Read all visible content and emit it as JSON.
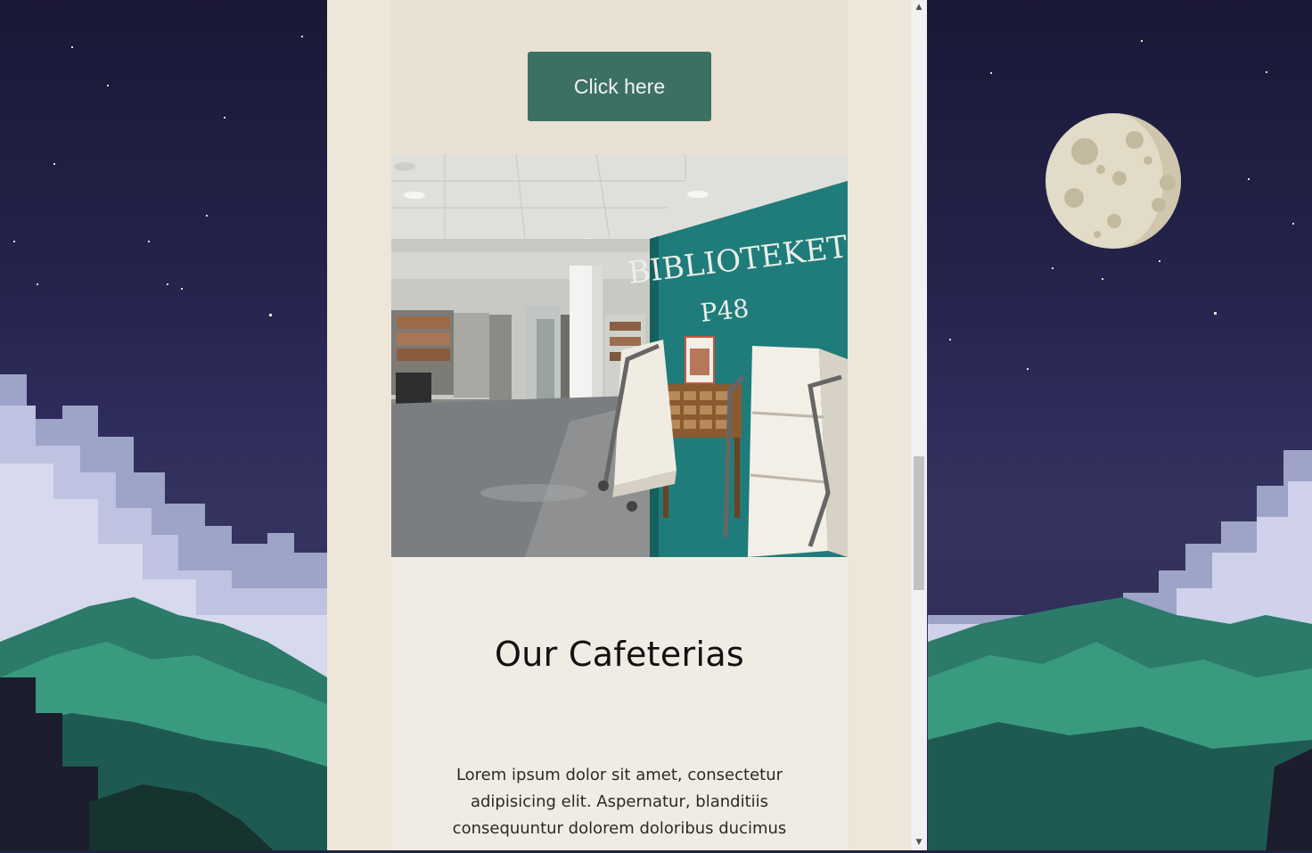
{
  "page": {
    "cta_label": "Click here",
    "section_title": "Our Cafeterias",
    "section_body": "Lorem ipsum dolor sit amet, consectetur adipisicing elit. Aspernatur, blanditiis consequuntur dolorem doloribus ducimus",
    "photo": {
      "sign_line1": "BIBLIOTEKET",
      "sign_line2": "P48"
    }
  },
  "icons": {
    "scroll_up": "triangle-up-icon",
    "scroll_down": "triangle-down-icon"
  },
  "colors": {
    "button_bg": "#3c7064",
    "button_text": "#f2f2f2",
    "panel_bg": "#ece5d8",
    "sky_dark": "#1a1836",
    "mountain": "#2d8a73",
    "sign_wall": "#1f7c7a"
  }
}
